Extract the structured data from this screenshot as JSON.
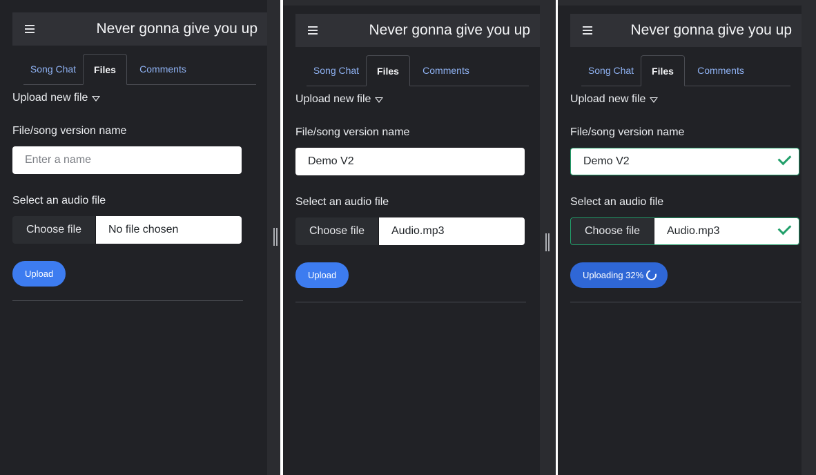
{
  "app": {
    "title": "Never gonna give you up"
  },
  "tabs": [
    "Song Chat",
    "Files",
    "Comments"
  ],
  "form": {
    "upload_toggle": "Upload new file",
    "name_label": "File/song version name",
    "name_placeholder": "Enter a name",
    "audio_label": "Select an audio file",
    "choose_button": "Choose file",
    "upload_button": "Upload"
  },
  "states": [
    {
      "name_value": "",
      "file_name": "No file chosen",
      "button_label": "Upload"
    },
    {
      "name_value": "Demo V2",
      "file_name": "Audio.mp3",
      "button_label": "Upload"
    },
    {
      "name_value": "Demo V2",
      "file_name": "Audio.mp3",
      "button_label": "Uploading 32%",
      "progress_percent": 32
    }
  ],
  "colors": {
    "background": "#212226",
    "topbar": "#303136",
    "accent": "#3d7cf0",
    "link": "#8fb2f3",
    "valid": "#22a06b"
  }
}
